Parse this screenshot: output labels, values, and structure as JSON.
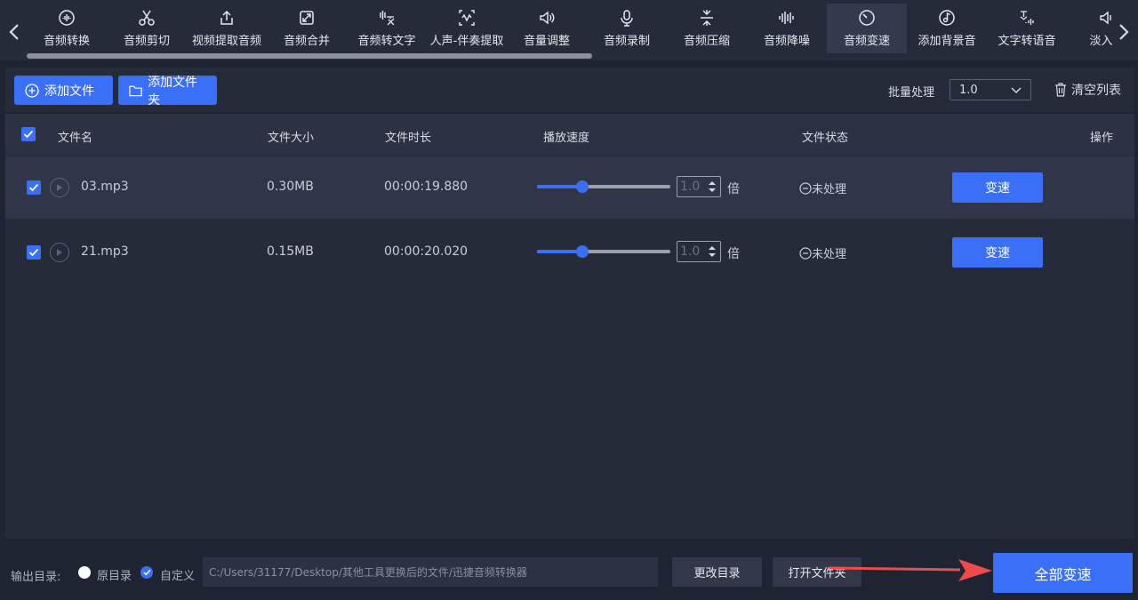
{
  "toolbar": {
    "tools": [
      {
        "label": "音频转换",
        "icon": "audio-convert-icon"
      },
      {
        "label": "音频剪切",
        "icon": "scissors-icon"
      },
      {
        "label": "视频提取音频",
        "icon": "upload-icon"
      },
      {
        "label": "音频合并",
        "icon": "merge-icon"
      },
      {
        "label": "音频转文字",
        "icon": "audio-to-text-icon"
      },
      {
        "label": "人声-伴奏提取",
        "icon": "voice-extract-icon"
      },
      {
        "label": "音量调整",
        "icon": "volume-icon"
      },
      {
        "label": "音频录制",
        "icon": "microphone-icon"
      },
      {
        "label": "音频压缩",
        "icon": "compress-icon"
      },
      {
        "label": "音频降噪",
        "icon": "waveform-icon"
      },
      {
        "label": "音频变速",
        "icon": "speed-dial-icon"
      },
      {
        "label": "添加背景音",
        "icon": "music-note-icon"
      },
      {
        "label": "文字转语音",
        "icon": "text-to-speech-icon"
      },
      {
        "label": "淡入淡",
        "icon": "fade-icon"
      }
    ],
    "active_tool": "音频变速",
    "scroll_fraction": 0.5
  },
  "actions": {
    "add_file": "添加文件",
    "add_folder": "添加文件夹",
    "batch_label": "批量处理",
    "batch_value": "1.0",
    "clear_list": "清空列表"
  },
  "table": {
    "headers": {
      "name": "文件名",
      "size": "文件大小",
      "duration": "文件时长",
      "speed": "播放速度",
      "status": "文件状态",
      "ops": "操作"
    },
    "rows": [
      {
        "name": "03.mp3",
        "size": "0.30MB",
        "duration": "00:00:19.880",
        "speed": "1.0",
        "speed_fraction": 0.34,
        "unit": "倍",
        "status": "未处理",
        "action": "变速",
        "checked": true
      },
      {
        "name": "21.mp3",
        "size": "0.15MB",
        "duration": "00:00:20.020",
        "speed": "1.0",
        "speed_fraction": 0.34,
        "unit": "倍",
        "status": "未处理",
        "action": "变速",
        "checked": true
      }
    ]
  },
  "bottom": {
    "output_label": "输出目录:",
    "option_original": "原目录",
    "option_custom": "自定义",
    "selected_option": "自定义",
    "path": "C:/Users/31177/Desktop/其他工具更换后的文件/迅捷音频转换器",
    "change_dir": "更改目录",
    "open_folder": "打开文件夹",
    "convert_all": "全部变速"
  },
  "colors": {
    "accent": "#3a6ff7",
    "annotation_arrow": "#f04a4a"
  }
}
